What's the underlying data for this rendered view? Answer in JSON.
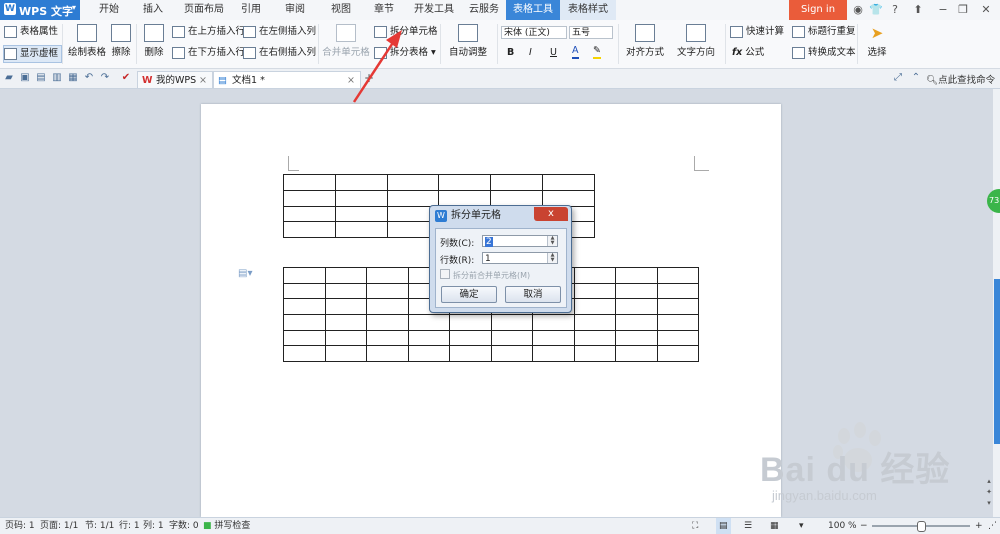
{
  "app": {
    "logo": "WPS 文字",
    "sign_in": "Sign in"
  },
  "menu_tabs": [
    "开始",
    "插入",
    "页面布局",
    "引用",
    "审阅",
    "视图",
    "章节",
    "开发工具",
    "云服务",
    "表格工具",
    "表格样式"
  ],
  "active_tab": "表格工具",
  "ribbon": {
    "table_props": "表格属性",
    "show_gridlines": "显示虚框",
    "draw_table": "绘制表格",
    "erase": "擦除",
    "delete": "删除",
    "insert_above": "在上方插入行",
    "insert_below": "在下方插入行",
    "insert_left": "在左侧插入列",
    "insert_right": "在右侧插入列",
    "merge_cells": "合并单元格",
    "split_cells": "拆分单元格",
    "split_table": "拆分表格",
    "auto_fit": "自动调整",
    "font_name": "宋体 (正文)",
    "font_size": "五号",
    "bold": "B",
    "italic": "I",
    "underline": "U",
    "font_color": "A",
    "align": "对齐方式",
    "text_direction": "文字方向",
    "quick_calc": "快速计算",
    "formula": "公式",
    "repeat_header": "标题行重复",
    "convert_text": "转换成文本",
    "select": "选择"
  },
  "doc_tabs": [
    {
      "label": "我的WPS",
      "close": "×"
    },
    {
      "label": "文档1 *",
      "close": "×"
    }
  ],
  "new_tab": "+",
  "search_command": "点此查找命令",
  "dialog": {
    "title": "拆分单元格",
    "close": "x",
    "cols_label": "列数(C):",
    "cols_value": "2",
    "rows_label": "行数(R):",
    "rows_value": "1",
    "merge_before_split": "拆分前合并单元格(M)",
    "ok": "确定",
    "cancel": "取消"
  },
  "status": {
    "page_code": "页码: 1",
    "pages": "页面: 1/1",
    "section": "节: 1/1",
    "row": "行: 1",
    "col": "列: 1",
    "word_count": "字数: 0",
    "spell_check": "拼写检查",
    "zoom": "100 %"
  },
  "side_badge": "73",
  "watermark": {
    "logo": "Bai du 经验",
    "url": "jingyan.baidu.com"
  },
  "colors": {
    "accent": "#3a86d8",
    "sign_in": "#ea5c3a",
    "workspace": "#d4dae3",
    "arrow": "#e53935"
  }
}
